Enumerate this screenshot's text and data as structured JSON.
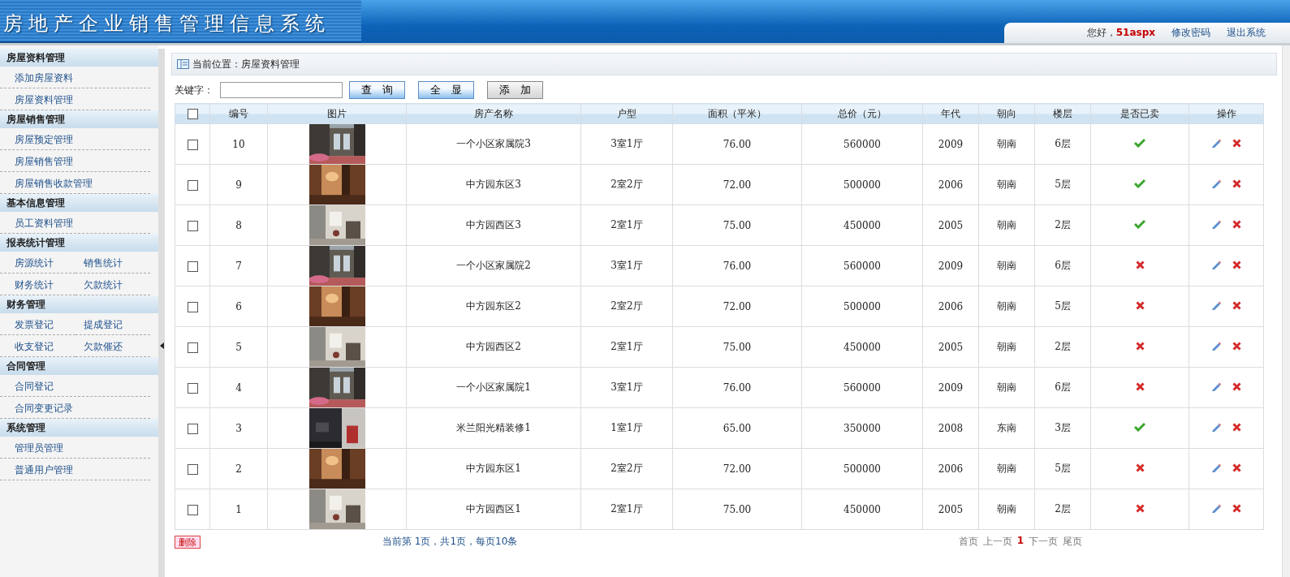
{
  "header": {
    "title": "房地产企业销售管理信息系统",
    "greeting": "您好，",
    "user": "51aspx",
    "links": [
      "修改密码",
      "退出系统"
    ]
  },
  "sidebar": {
    "sections": [
      {
        "title": "房屋资料管理",
        "kind": "list",
        "items": [
          "添加房屋资料",
          "房屋资料管理"
        ]
      },
      {
        "title": "房屋销售管理",
        "kind": "list",
        "items": [
          "房屋预定管理",
          "房屋销售管理",
          "房屋销售收款管理"
        ]
      },
      {
        "title": "基本信息管理",
        "kind": "list",
        "items": [
          "员工资料管理"
        ]
      },
      {
        "title": "报表统计管理",
        "kind": "grid",
        "items": [
          "房源统计",
          "销售统计",
          "财务统计",
          "欠款统计"
        ]
      },
      {
        "title": "财务管理",
        "kind": "grid",
        "items": [
          "发票登记",
          "提成登记",
          "收支登记",
          "欠款催还"
        ]
      },
      {
        "title": "合同管理",
        "kind": "list",
        "items": [
          "合同登记",
          "合同变更记录"
        ]
      },
      {
        "title": "系统管理",
        "kind": "list",
        "items": [
          "管理员管理",
          "普通用户管理"
        ]
      }
    ]
  },
  "breadcrumb": "当前位置：房屋资料管理",
  "search": {
    "label": "关键字：",
    "buttons": [
      "查　询",
      "全　显",
      "添　加"
    ]
  },
  "table": {
    "select_all": {
      "checked": false
    },
    "columns": [
      "编号",
      "图片",
      "房产名称",
      "户型",
      "面积（平米）",
      "总价（元）",
      "年代",
      "朝向",
      "楼层",
      "是否已卖",
      "操作"
    ],
    "rows": [
      {
        "checked": false,
        "id": "10",
        "name": "一个小区家属院3",
        "layout": "3室1厅",
        "area": "76.00",
        "price": "560000",
        "year": "2009",
        "facing": "朝南",
        "floor": "6层",
        "sold": true
      },
      {
        "checked": false,
        "id": "9",
        "name": "中方园东区3",
        "layout": "2室2厅",
        "area": "72.00",
        "price": "500000",
        "year": "2006",
        "facing": "朝南",
        "floor": "5层",
        "sold": true
      },
      {
        "checked": false,
        "id": "8",
        "name": "中方园西区3",
        "layout": "2室1厅",
        "area": "75.00",
        "price": "450000",
        "year": "2005",
        "facing": "朝南",
        "floor": "2层",
        "sold": true
      },
      {
        "checked": false,
        "id": "7",
        "name": "一个小区家属院2",
        "layout": "3室1厅",
        "area": "76.00",
        "price": "560000",
        "year": "2009",
        "facing": "朝南",
        "floor": "6层",
        "sold": false
      },
      {
        "checked": false,
        "id": "6",
        "name": "中方园东区2",
        "layout": "2室2厅",
        "area": "72.00",
        "price": "500000",
        "year": "2006",
        "facing": "朝南",
        "floor": "5层",
        "sold": false
      },
      {
        "checked": false,
        "id": "5",
        "name": "中方园西区2",
        "layout": "2室1厅",
        "area": "75.00",
        "price": "450000",
        "year": "2005",
        "facing": "朝南",
        "floor": "2层",
        "sold": false
      },
      {
        "checked": false,
        "id": "4",
        "name": "一个小区家属院1",
        "layout": "3室1厅",
        "area": "76.00",
        "price": "560000",
        "year": "2009",
        "facing": "朝南",
        "floor": "6层",
        "sold": false
      },
      {
        "checked": false,
        "id": "3",
        "name": "米兰阳光精装修1",
        "layout": "1室1厅",
        "area": "65.00",
        "price": "350000",
        "year": "2008",
        "facing": "东南",
        "floor": "3层",
        "sold": true
      },
      {
        "checked": false,
        "id": "2",
        "name": "中方园东区1",
        "layout": "2室2厅",
        "area": "72.00",
        "price": "500000",
        "year": "2006",
        "facing": "朝南",
        "floor": "5层",
        "sold": false
      },
      {
        "checked": false,
        "id": "1",
        "name": "中方园西区1",
        "layout": "2室1厅",
        "area": "75.00",
        "price": "450000",
        "year": "2005",
        "facing": "朝南",
        "floor": "2层",
        "sold": false
      }
    ]
  },
  "footer": {
    "delete": "删除",
    "info": "当前第 1页，共1页，每页10条",
    "pager": [
      {
        "label": "首页",
        "selected": false
      },
      {
        "label": "上一页",
        "selected": false
      },
      {
        "label": "1",
        "selected": true
      },
      {
        "label": "下一页",
        "selected": false
      },
      {
        "label": "尾页",
        "selected": false
      }
    ]
  }
}
